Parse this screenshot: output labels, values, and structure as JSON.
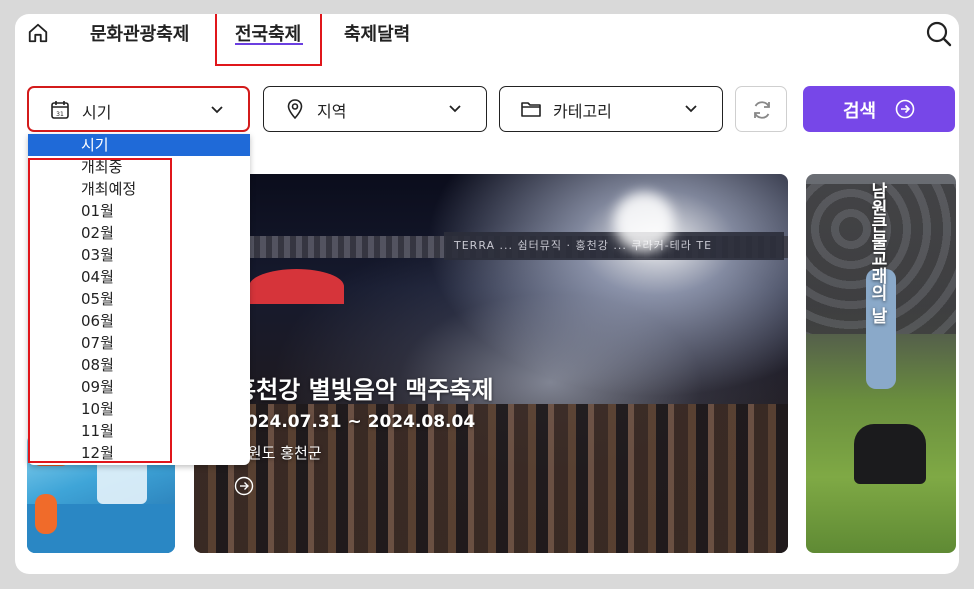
{
  "nav": {
    "tabs": [
      {
        "label": "문화관광축제"
      },
      {
        "label": "전국축제"
      },
      {
        "label": "축제달력"
      }
    ],
    "active_tab": "전국축제"
  },
  "filters": {
    "time": {
      "label": "시기"
    },
    "region": {
      "label": "지역"
    },
    "category": {
      "label": "카테고리"
    },
    "search_button": {
      "label": "검색"
    }
  },
  "dropdown": {
    "options": [
      "시기",
      "개최중",
      "개최예정",
      "01월",
      "02월",
      "03월",
      "04월",
      "05월",
      "06월",
      "07월",
      "08월",
      "09월",
      "10월",
      "11월",
      "12월"
    ],
    "selected": "시기"
  },
  "featured": {
    "title": "홍천강 별빛음악 맥주축제",
    "dates": "2024.07.31 ~ 2024.08.04",
    "location": "강원도 홍천군"
  },
  "side_card": {
    "title": "남원큰물교래의 날"
  },
  "main_banner_text": "TERRA  ... 쉼터뮤직 · 홍천강 ... 쿠라커-테라 TE",
  "colors": {
    "accent": "#7747e8",
    "highlight": "#e0161b",
    "selected_option": "#1f6ad8"
  }
}
